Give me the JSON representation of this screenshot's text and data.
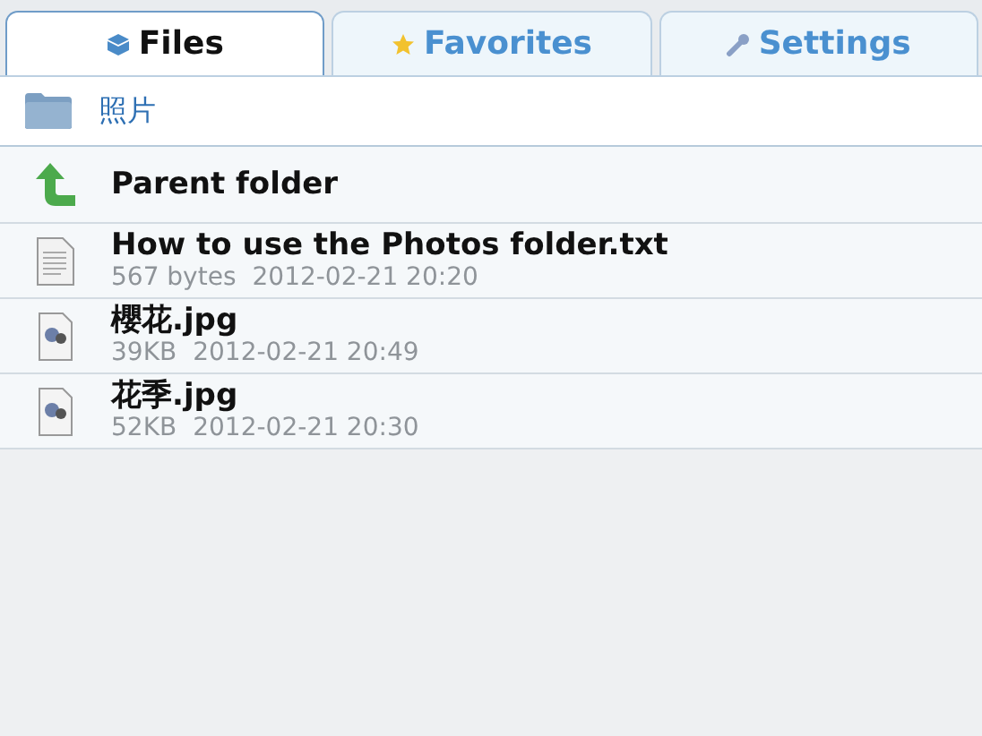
{
  "tabs": [
    {
      "label": "Files",
      "kind": "box",
      "selected": true
    },
    {
      "label": "Favorites",
      "kind": "star",
      "selected": false
    },
    {
      "label": "Settings",
      "kind": "wrench",
      "selected": false
    }
  ],
  "path": {
    "label": "照片"
  },
  "items": [
    {
      "kind": "parent",
      "name": "Parent folder"
    },
    {
      "kind": "text",
      "name": "How to use the Photos folder.txt",
      "size": "567 bytes",
      "date": "2012-02-21 20:20"
    },
    {
      "kind": "image",
      "name": "櫻花.jpg",
      "size": "39KB",
      "date": "2012-02-21 20:49"
    },
    {
      "kind": "image",
      "name": "花季.jpg",
      "size": "52KB",
      "date": "2012-02-21 20:30"
    }
  ]
}
